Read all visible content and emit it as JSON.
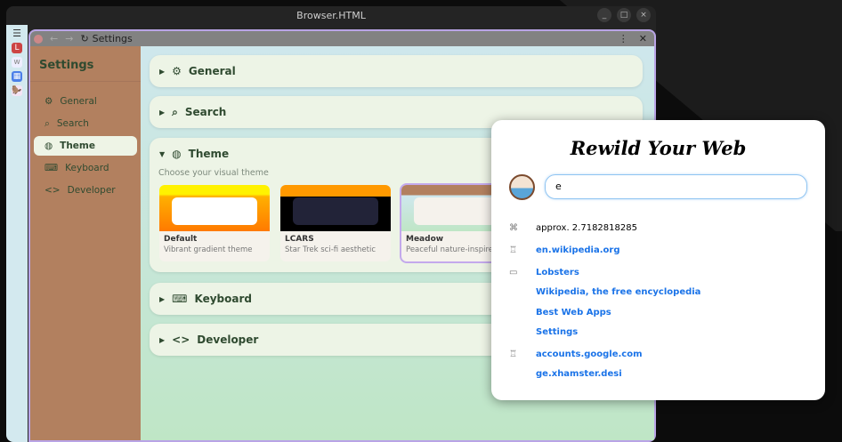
{
  "os": {
    "title": "Browser.HTML",
    "min": "_",
    "max": "□",
    "close": "×"
  },
  "strip": {
    "items": [
      "L",
      "w",
      "▦",
      "🦫"
    ],
    "menu": "☰"
  },
  "toolbar": {
    "back": "←",
    "forward": "→",
    "reload": "↻",
    "title": "Settings",
    "more": "⋮",
    "close": "✕"
  },
  "sidebar": {
    "title": "Settings",
    "items": [
      {
        "label": "General",
        "icon": "⚙"
      },
      {
        "label": "Search",
        "icon": "⌕"
      },
      {
        "label": "Theme",
        "icon": "◍"
      },
      {
        "label": "Keyboard",
        "icon": "⌨"
      },
      {
        "label": "Developer",
        "icon": "<>"
      }
    ],
    "active": "Theme"
  },
  "sections": {
    "general": "General",
    "search": "Search",
    "theme": "Theme",
    "keyboard": "Keyboard",
    "developer": "Developer"
  },
  "theme": {
    "subtitle": "Choose your visual theme",
    "options": [
      {
        "name": "Default",
        "desc": "Vibrant gradient theme"
      },
      {
        "name": "LCARS",
        "desc": "Star Trek sci-fi aesthetic"
      },
      {
        "name": "Meadow",
        "desc": "Peaceful nature-inspired"
      }
    ],
    "selected": "Meadow"
  },
  "popup": {
    "title": "Rewild Your Web",
    "query": "e",
    "results": [
      {
        "icon": "calculator",
        "text": "approx. 2.7182818285"
      },
      {
        "icon": "trophy",
        "text": "en.wikipedia.org"
      },
      {
        "icon": "tab",
        "text": "Lobsters"
      },
      {
        "icon": "",
        "text": "Wikipedia, the free encyclopedia"
      },
      {
        "icon": "",
        "text": "Best Web Apps"
      },
      {
        "icon": "",
        "text": "Settings"
      },
      {
        "icon": "trophy",
        "text": "accounts.google.com"
      },
      {
        "icon": "",
        "text": "ge.xhamster.desi"
      }
    ]
  },
  "colors": {
    "sidebar": "#b2805f",
    "card": "#edf4e6",
    "link": "#1a73e8",
    "accent": "#b9a4e6"
  }
}
